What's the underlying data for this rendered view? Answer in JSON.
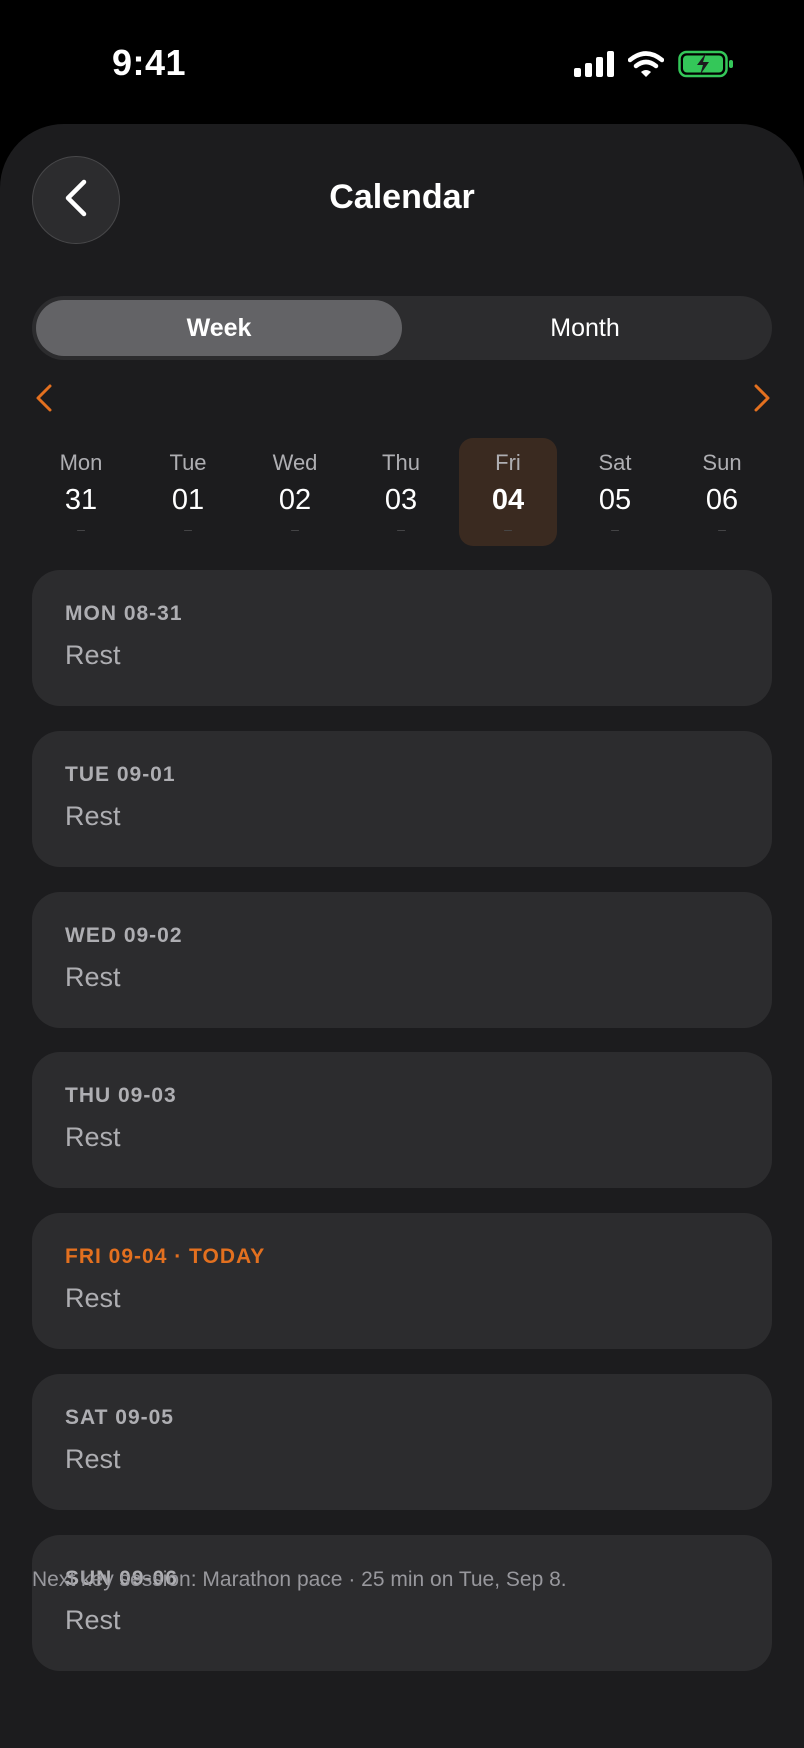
{
  "status_bar": {
    "time": "9:41",
    "icons": [
      "signal-icon",
      "wifi-icon",
      "battery-charging-icon"
    ]
  },
  "header": {
    "title": "Calendar",
    "back_icon": "chevron-left-icon"
  },
  "view_toggle": {
    "week_label": "Week",
    "month_label": "Month",
    "selected": "Week"
  },
  "week_nav": {
    "prev_icon": "chevron-left-icon",
    "next_icon": "chevron-right-icon"
  },
  "week_days": [
    {
      "name": "Mon",
      "num": "31",
      "marker": "–"
    },
    {
      "name": "Tue",
      "num": "01",
      "marker": "–"
    },
    {
      "name": "Wed",
      "num": "02",
      "marker": "–"
    },
    {
      "name": "Thu",
      "num": "03",
      "marker": "–"
    },
    {
      "name": "Fri",
      "num": "04",
      "marker": "–",
      "selected": true
    },
    {
      "name": "Sat",
      "num": "05",
      "marker": "–"
    },
    {
      "name": "Sun",
      "num": "06",
      "marker": "–"
    }
  ],
  "day_cards": [
    {
      "date": "MON 08-31",
      "status": "Rest"
    },
    {
      "date": "TUE 09-01",
      "status": "Rest"
    },
    {
      "date": "WED 09-02",
      "status": "Rest"
    },
    {
      "date": "THU 09-03",
      "status": "Rest"
    },
    {
      "date": "FRI 09-04 · TODAY",
      "status": "Rest",
      "today": true
    },
    {
      "date": "SAT 09-05",
      "status": "Rest"
    },
    {
      "date": "SUN 09-06",
      "status": "Rest"
    }
  ],
  "footer": {
    "note": "Next key session: Marathon pace · 25 min on Tue, Sep 8."
  },
  "colors": {
    "accent": "#e3701f",
    "background": "#1c1c1e",
    "card": "#2c2c2e",
    "battery": "#34c759"
  }
}
